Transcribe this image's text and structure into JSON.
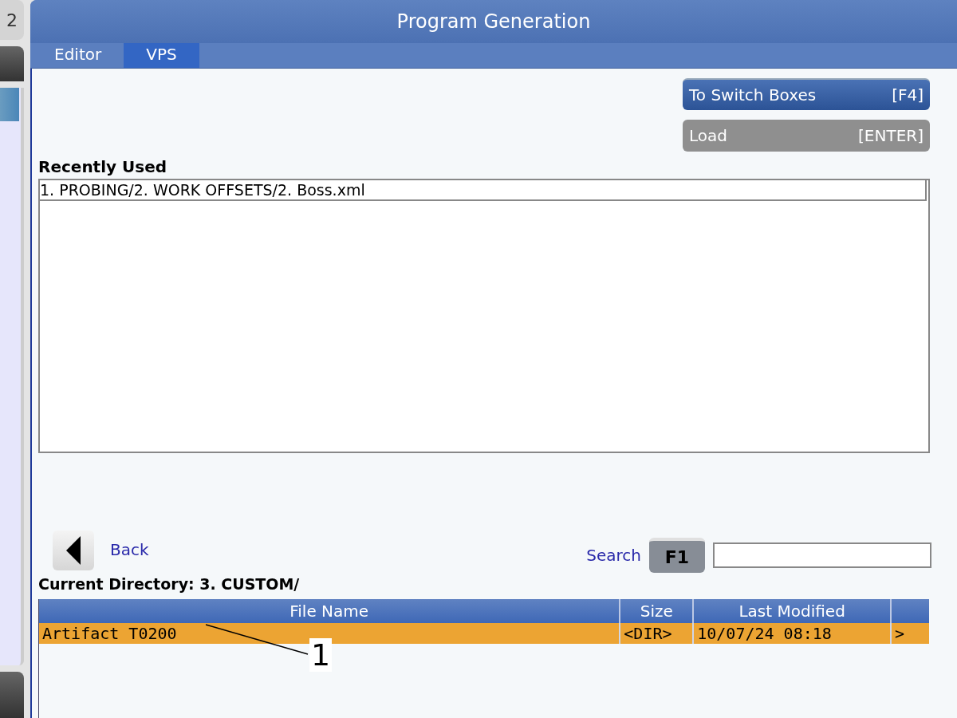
{
  "side_panel": {
    "label": "2"
  },
  "window": {
    "title": "Program Generation"
  },
  "tabs": [
    {
      "label": "Editor",
      "selected": false
    },
    {
      "label": "VPS",
      "selected": true
    }
  ],
  "buttons": [
    {
      "label": "To Switch Boxes",
      "key": "[F4]",
      "disabled": false
    },
    {
      "label": "Load",
      "key": "[ENTER]",
      "disabled": true
    }
  ],
  "recently_used": {
    "title": "Recently Used",
    "items": [
      {
        "label": "1. PROBING/2. WORK OFFSETS/2. Boss.xml",
        "selected": true
      }
    ]
  },
  "back": {
    "label": "Back"
  },
  "search": {
    "label": "Search",
    "key": "F1"
  },
  "current_directory": "Current Directory: 3. CUSTOM/",
  "table": {
    "columns": [
      "File Name",
      "Size",
      "Last Modified"
    ],
    "rows": [
      {
        "cells": [
          "Artifact T0200",
          "<DIR>",
          "10/07/24 08:18",
          ">"
        ],
        "selected": true
      }
    ]
  },
  "callout": "1"
}
